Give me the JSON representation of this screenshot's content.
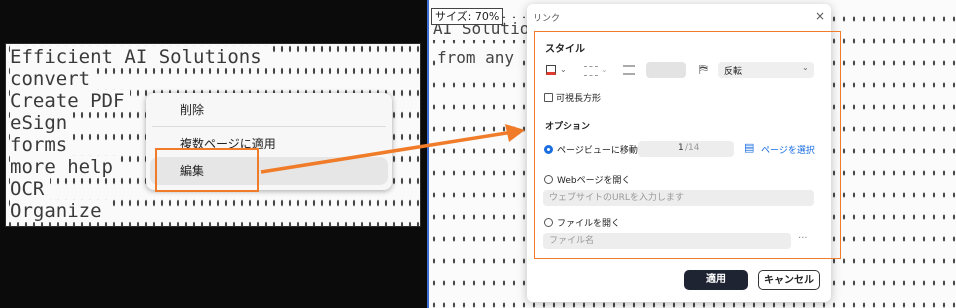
{
  "left_doc": {
    "lines": [
      "Efficient AI Solutions",
      "convert",
      "Create PDF",
      "eSign",
      "forms",
      "more help",
      "OCR",
      "Organize"
    ]
  },
  "context_menu": {
    "items": [
      "削除",
      "複数ページに適用",
      "編集"
    ]
  },
  "right_doc": {
    "zoom_label": "サイズ: 70%",
    "lines": [
      "AI Solutio",
      "from any"
    ]
  },
  "dialog": {
    "title": "リンク",
    "close_icon": "close-icon",
    "style_heading": "スタイル",
    "invert_label": "反転",
    "visible_rect_label": "可視長方形",
    "options_heading": "オプション",
    "page_view_label": "ページビューに移動",
    "page_current": "1",
    "page_total": "/14",
    "select_page_label": "ページを選択",
    "web_label": "Webページを開く",
    "web_placeholder": "ウェブサイトのURLを入力します",
    "file_label": "ファイルを開く",
    "file_placeholder": "ファイル名",
    "more_label": "···",
    "apply_label": "適用",
    "cancel_label": "キャンセル"
  },
  "colors": {
    "accent": "#1a6ee0",
    "highlight": "#f07c2a",
    "primary_button": "#1f2433",
    "border_red": "#e03b2f"
  }
}
